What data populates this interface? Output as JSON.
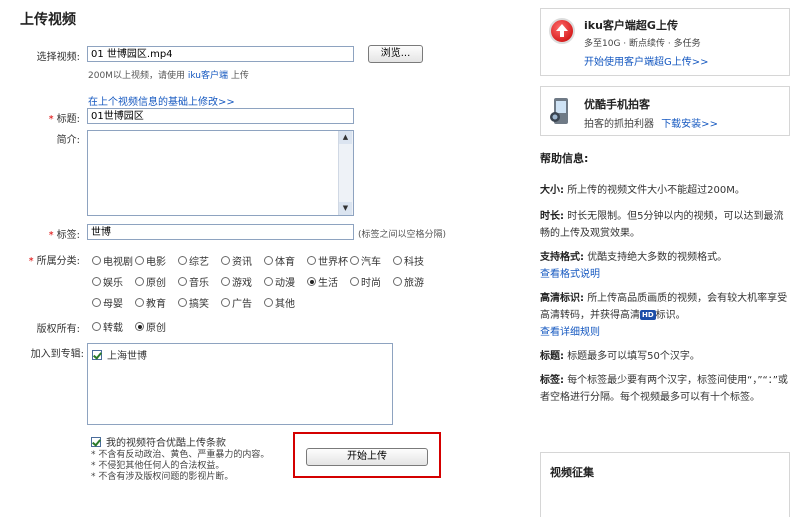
{
  "page": {
    "title": "上传视频"
  },
  "form": {
    "file_label": "选择视频:",
    "file_value": "01 世博园区.mp4",
    "browse_label": "浏览...",
    "size_hint_pre": "200M以上视频，请使用",
    "size_hint_link": "iku客户端",
    "size_hint_post": "上传",
    "edit_prev_link": "在上个视频信息的基础上修改>>",
    "title_label": "标题:",
    "title_value": "01世博园区",
    "intro_label": "简介:",
    "tags_label": "标签:",
    "tags_value": "世博",
    "tags_hint": "(标签之间以空格分隔)",
    "category_label": "所属分类:",
    "categories": [
      [
        {
          "label": "电视剧",
          "checked": false
        },
        {
          "label": "电影",
          "checked": false
        },
        {
          "label": "综艺",
          "checked": false
        },
        {
          "label": "资讯",
          "checked": false
        },
        {
          "label": "体育",
          "checked": false
        },
        {
          "label": "世界杯",
          "checked": false
        },
        {
          "label": "汽车",
          "checked": false
        },
        {
          "label": "科技",
          "checked": false
        }
      ],
      [
        {
          "label": "娱乐",
          "checked": false
        },
        {
          "label": "原创",
          "checked": false
        },
        {
          "label": "音乐",
          "checked": false
        },
        {
          "label": "游戏",
          "checked": false
        },
        {
          "label": "动漫",
          "checked": false
        },
        {
          "label": "生活",
          "checked": true
        },
        {
          "label": "时尚",
          "checked": false
        },
        {
          "label": "旅游",
          "checked": false
        }
      ],
      [
        {
          "label": "母婴",
          "checked": false
        },
        {
          "label": "教育",
          "checked": false
        },
        {
          "label": "搞笑",
          "checked": false
        },
        {
          "label": "广告",
          "checked": false
        },
        {
          "label": "其他",
          "checked": false
        }
      ]
    ],
    "copyright_label": "版权所有:",
    "copyright_options": [
      {
        "label": "转载",
        "checked": false
      },
      {
        "label": "原创",
        "checked": true
      }
    ],
    "album_label": "加入到专辑:",
    "album_items": [
      {
        "label": "上海世博",
        "checked": true
      }
    ],
    "agree_label": "我的视频符合优酷上传条款",
    "agree_checked": true,
    "rules": [
      "* 不含有反动政治、黄色、严重暴力的内容。",
      "* 不侵犯其他任何人的合法权益。",
      "* 不含有涉及版权问题的影视片断。"
    ],
    "submit_label": "开始上传"
  },
  "sidebar": {
    "promo1": {
      "title": "iku客户端超G上传",
      "desc": "多至10G · 断点续传 · 多任务",
      "link": "开始使用客户端超G上传>>"
    },
    "promo2": {
      "title": "优酷手机拍客",
      "desc": "拍客的抓拍利器",
      "link": "下载安装>>"
    },
    "help_title": "帮助信息:",
    "help": [
      {
        "key": "大小:",
        "text": "所上传的视频文件大小不能超过200M。"
      },
      {
        "key": "时长:",
        "text": "时长无限制。但5分钟以内的视频，可以达到最流畅的上传及观赏效果。"
      },
      {
        "key": "支持格式:",
        "text": "优酷支持绝大多数的视频格式。",
        "link": "查看格式说明"
      },
      {
        "key": "高清标识:",
        "text_pre": "所上传高品质画质的视频，会有较大机率享受高清转码，并获得高清",
        "badge": "HD",
        "text_post": "标识。",
        "link": "查看详细规则"
      },
      {
        "key": "标题:",
        "text": "标题最多可以填写50个汉字。"
      },
      {
        "key": "标签:",
        "text": "每个标签最少要有两个汉字，标签间使用“，”“：”或者空格进行分隔。每个视频最多可以有十个标签。"
      }
    ],
    "collect_title": "视频征集"
  }
}
